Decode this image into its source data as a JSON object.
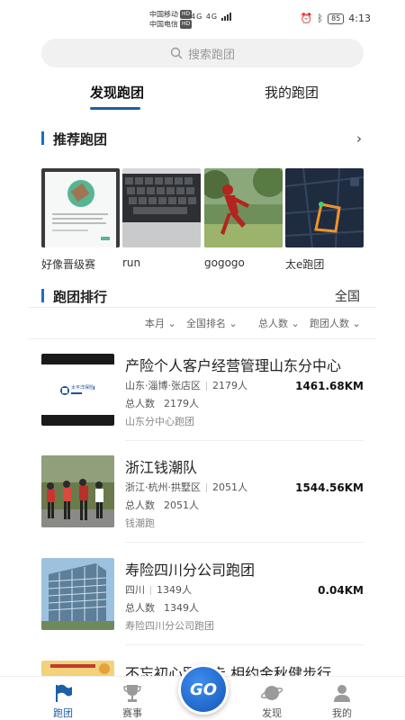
{
  "status": {
    "carrier1": "中国移动",
    "carrier2": "中国电信",
    "hd": "HD",
    "net": "4G 4G",
    "battery": "85",
    "time": "4:13"
  },
  "search": {
    "placeholder": "搜索跑团"
  },
  "tabs": [
    {
      "label": "发现跑团",
      "active": true
    },
    {
      "label": "我的跑团",
      "active": false
    }
  ],
  "recommended": {
    "title": "推荐跑团",
    "items": [
      {
        "label": "好像晋级赛",
        "image": "phone-app-screenshot"
      },
      {
        "label": "run",
        "image": "laptop-keyboard"
      },
      {
        "label": "gogogo",
        "image": "runner-sculpture"
      },
      {
        "label": "太e跑团",
        "image": "running-route-map"
      }
    ]
  },
  "ranking": {
    "title": "跑团排行",
    "scope": "全国",
    "filters": [
      "本月",
      "全国排名",
      "总人数",
      "跑团人数"
    ]
  },
  "teams": [
    {
      "name": "产险个人客户经营管理山东分中心",
      "location": "山东·淄博·张店区",
      "members": "2179人",
      "total_label": "总人数",
      "total": "2179人",
      "team_name": "山东分中心跑团",
      "distance": "1461.68KM",
      "thumb": "insurance-logo",
      "logo_text": "太平洋保险"
    },
    {
      "name": "浙江钱潮队",
      "location": "浙江·杭州·拱墅区",
      "members": "2051人",
      "total_label": "总人数",
      "total": "2051人",
      "team_name": "钱潮跑",
      "distance": "1544.56KM",
      "thumb": "marathon-runners"
    },
    {
      "name": "寿险四川分公司跑团",
      "location": "四川",
      "members": "1349人",
      "total_label": "总人数",
      "total": "1349人",
      "team_name": "寿险四川分公司跑团",
      "distance": "0.04KM",
      "thumb": "office-building"
    },
    {
      "name": "不忘初心跟党走 相约金秋健步行",
      "thumb": "event-banner"
    }
  ],
  "nav": [
    {
      "label": "跑团",
      "icon": "flag-icon",
      "active": true
    },
    {
      "label": "赛事",
      "icon": "trophy-icon",
      "active": false
    },
    {
      "label": "发现",
      "icon": "planet-icon",
      "active": false
    },
    {
      "label": "我的",
      "icon": "user-icon",
      "active": false
    }
  ],
  "go_label": "GO",
  "colors": {
    "accent": "#1c5fa8",
    "divider": "#eeeeee"
  }
}
